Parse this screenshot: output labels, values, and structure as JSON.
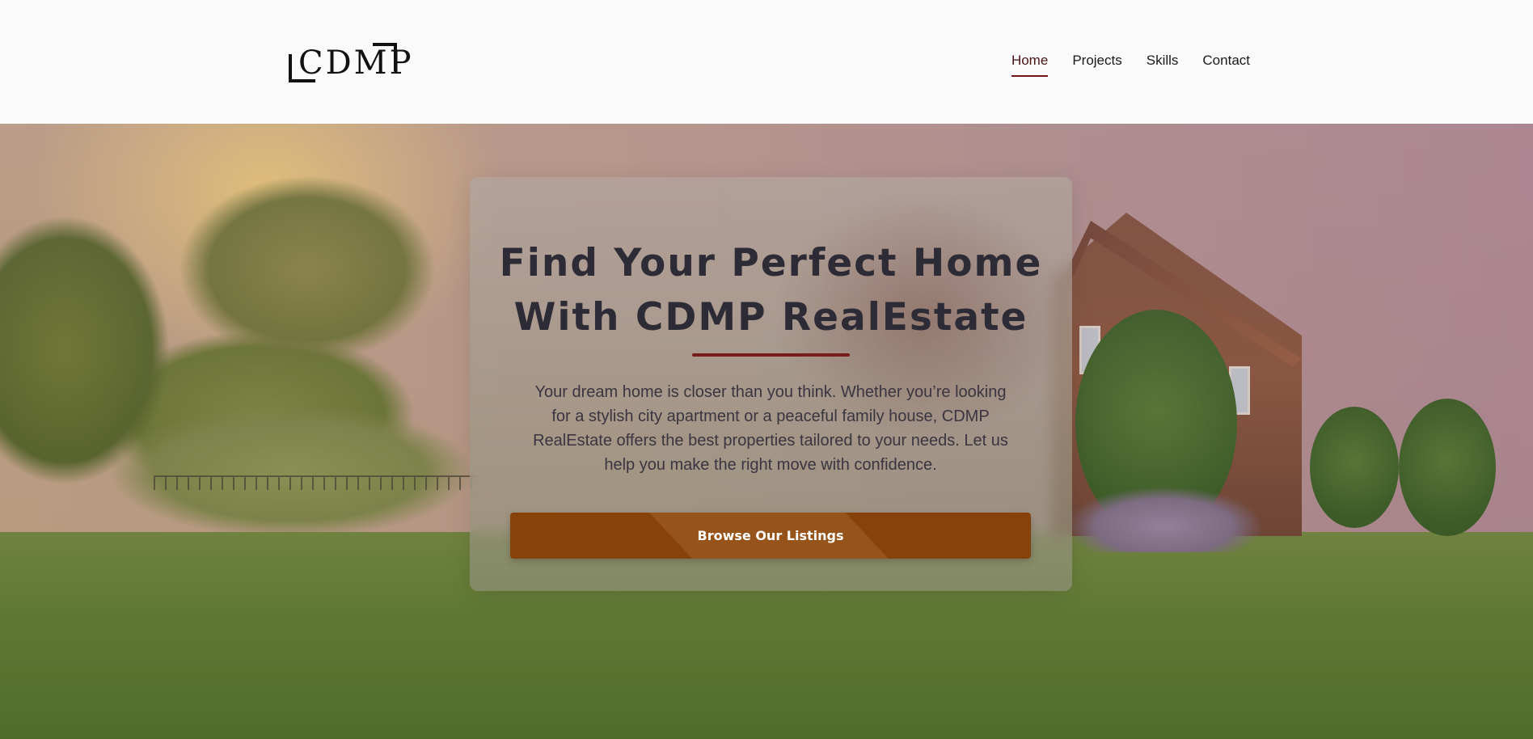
{
  "header": {
    "logo_text": "CDMP",
    "nav": [
      {
        "label": "Home",
        "active": true
      },
      {
        "label": "Projects",
        "active": false
      },
      {
        "label": "Skills",
        "active": false
      },
      {
        "label": "Contact",
        "active": false
      }
    ]
  },
  "hero": {
    "title_line1": "Find Your Perfect Home",
    "title_line2": "With CDMP RealEstate",
    "description": "Your dream home is closer than you think. Whether you’re looking for a stylish city apartment or a peaceful family house, CDMP RealEstate offers the best properties tailored to your needs. Let us help you make the right move with confidence.",
    "cta_label": "Browse Our Listings"
  },
  "colors": {
    "accent_dark_red": "#6e1414",
    "cta_brown": "#864208",
    "title_text": "#2d2b36"
  }
}
